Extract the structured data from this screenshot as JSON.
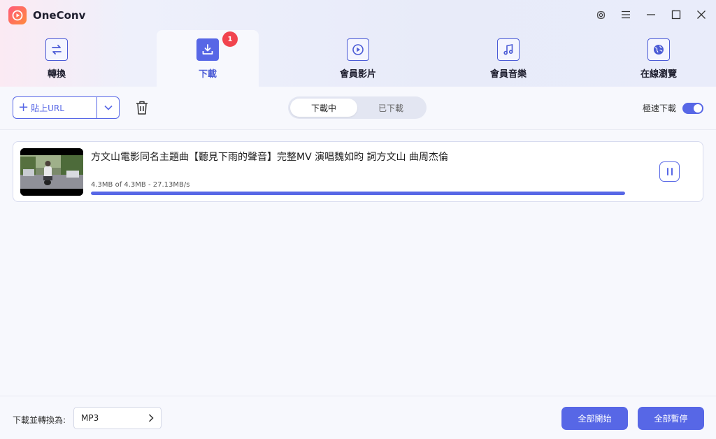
{
  "app": {
    "title": "OneConv"
  },
  "window_controls": [
    "gear-icon",
    "menu-icon",
    "minimize-icon",
    "maximize-icon",
    "close-icon"
  ],
  "tabs": [
    {
      "label": "轉換",
      "icon": "convert-icon",
      "active": false
    },
    {
      "label": "下載",
      "icon": "download-icon",
      "active": true,
      "badge": "1"
    },
    {
      "label": "會員影片",
      "icon": "play-icon",
      "active": false
    },
    {
      "label": "會員音樂",
      "icon": "music-icon",
      "active": false
    },
    {
      "label": "在線瀏覽",
      "icon": "globe-icon",
      "active": false
    }
  ],
  "toolbar": {
    "paste_url_label": "貼上URL",
    "segments": [
      {
        "label": "下載中",
        "active": true
      },
      {
        "label": "已下載",
        "active": false
      }
    ],
    "turbo_label": "極速下載",
    "turbo_on": true
  },
  "downloads": [
    {
      "title": "方文山電影同名主題曲【聽見下雨的聲音】完整MV 演唱魏如昀 詞方文山 曲周杰倫",
      "meta": "4.3MB of 4.3MB -    27.13MB/s",
      "progress": 1.0
    }
  ],
  "bottom": {
    "convert_label": "下載並轉換為:",
    "format_value": "MP3",
    "start_all_label": "全部開始",
    "pause_all_label": "全部暫停"
  },
  "colors": {
    "accent": "#5767e6",
    "badge": "#f1444e"
  }
}
